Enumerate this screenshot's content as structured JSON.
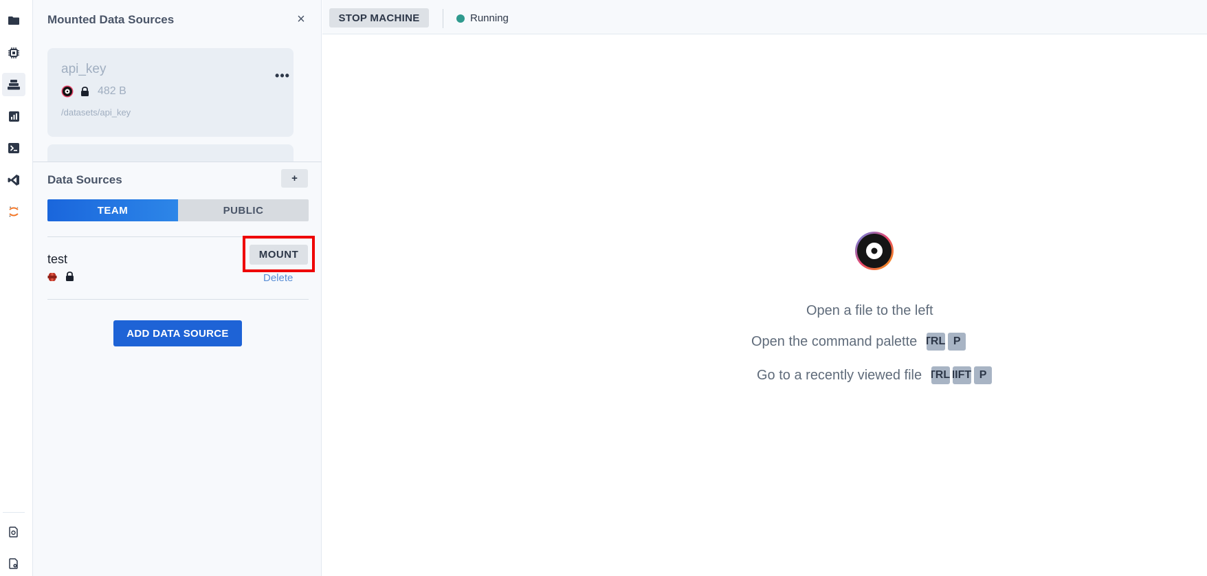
{
  "activity_bar": {
    "items": [
      {
        "name": "folder-icon",
        "active": false
      },
      {
        "name": "chip-icon",
        "active": false
      },
      {
        "name": "datasets-icon",
        "active": true
      },
      {
        "name": "chart-icon",
        "active": false
      },
      {
        "name": "terminal-icon",
        "active": false
      },
      {
        "name": "vscode-icon",
        "active": false
      },
      {
        "name": "jupyter-icon",
        "active": false
      }
    ],
    "bottom_items": [
      {
        "name": "docs-icon"
      },
      {
        "name": "settings-file-icon"
      }
    ]
  },
  "mounted": {
    "title": "Mounted Data Sources",
    "close_label": "×",
    "cards": [
      {
        "name": "api_key",
        "size": "482 B",
        "path": "/datasets/api_key",
        "more_label": "•••"
      }
    ]
  },
  "data_sources": {
    "title": "Data Sources",
    "add_label": "+",
    "tabs": {
      "team": "TEAM",
      "public": "PUBLIC"
    },
    "items": [
      {
        "name": "test",
        "mount_label": "MOUNT",
        "delete_label": "Delete"
      }
    ],
    "add_button_label": "ADD DATA SOURCE"
  },
  "toolbar": {
    "stop_label": "STOP MACHINE",
    "status_text": "Running",
    "status_color": "#2f9a8e"
  },
  "editor": {
    "hint_open_file": "Open a file to the left",
    "hint_palette": "Open the command palette",
    "hint_palette_keys": [
      "TRL",
      "P"
    ],
    "hint_recent": "Go to a recently viewed file",
    "hint_recent_keys": [
      "TRL",
      "HIFT",
      "P"
    ]
  },
  "colors": {
    "accent": "#1e63d6",
    "highlight": "#ee0000"
  }
}
